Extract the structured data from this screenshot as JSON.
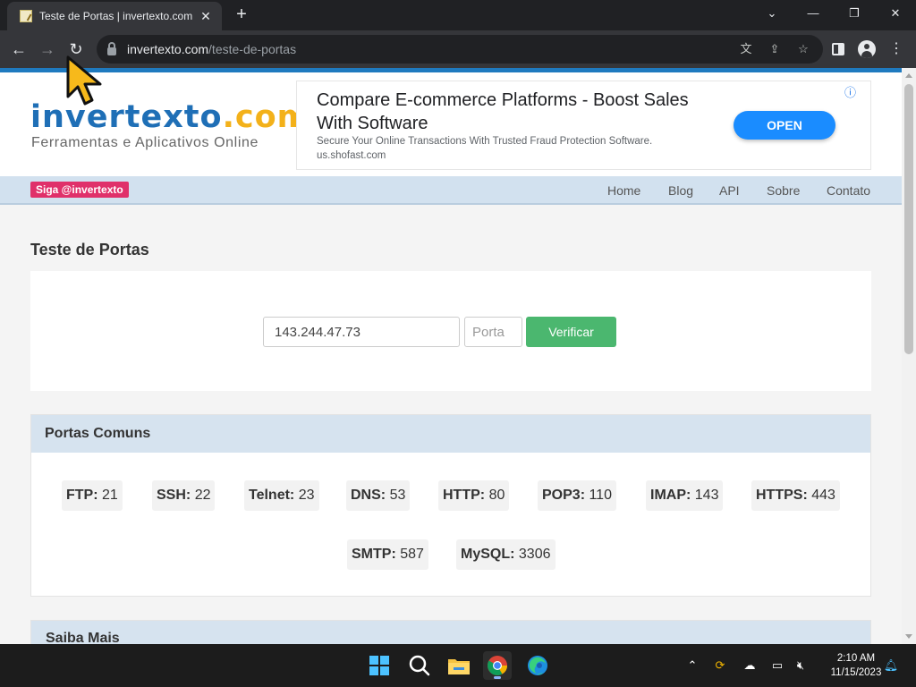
{
  "browser": {
    "tab_title": "Teste de Portas | invertexto.com",
    "url_host": "invertexto.com",
    "url_path": "/teste-de-portas"
  },
  "site": {
    "logo_main": "invertexto",
    "logo_dotcom": ".com",
    "logo_tagline": "Ferramentas e Aplicativos Online"
  },
  "ad": {
    "title": "Compare E-commerce Platforms - Boost Sales With Software",
    "description": "Secure Your Online Transactions With Trusted Fraud Protection Software.",
    "url": "us.shofast.com",
    "button": "OPEN"
  },
  "nav": {
    "social": "Siga @invertexto",
    "links": [
      "Home",
      "Blog",
      "API",
      "Sobre",
      "Contato"
    ]
  },
  "page": {
    "title": "Teste de Portas",
    "ip_value": "143.244.47.73",
    "port_placeholder": "Porta",
    "verify_button": "Verificar"
  },
  "ports": {
    "heading": "Portas Comuns",
    "items": [
      {
        "name": "FTP:",
        "port": "21"
      },
      {
        "name": "SSH:",
        "port": "22"
      },
      {
        "name": "Telnet:",
        "port": "23"
      },
      {
        "name": "DNS:",
        "port": "53"
      },
      {
        "name": "HTTP:",
        "port": "80"
      },
      {
        "name": "POP3:",
        "port": "110"
      },
      {
        "name": "IMAP:",
        "port": "143"
      },
      {
        "name": "HTTPS:",
        "port": "443"
      },
      {
        "name": "SMTP:",
        "port": "587"
      },
      {
        "name": "MySQL:",
        "port": "3306"
      }
    ]
  },
  "more": {
    "heading": "Saiba Mais"
  },
  "taskbar": {
    "time": "2:10 AM",
    "date": "11/15/2023"
  },
  "colors": {
    "brand_blue": "#1f6fb6",
    "brand_yellow": "#f3b11a",
    "verify_green": "#4bb76f",
    "social_pink": "#e0306a",
    "ad_button_blue": "#1a8cff"
  }
}
